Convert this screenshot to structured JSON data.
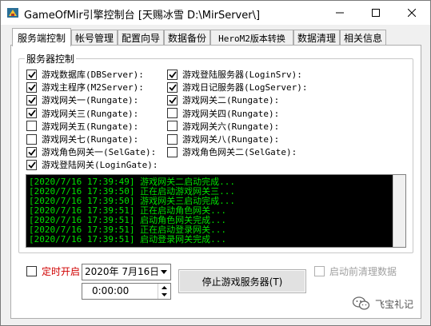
{
  "window": {
    "title": "GameOfMir引擎控制台 [天赐冰雪 D:\\MirServer\\]"
  },
  "tabs": [
    {
      "label": "服务端控制",
      "active": true
    },
    {
      "label": "帐号管理",
      "active": false
    },
    {
      "label": "配置向导",
      "active": false
    },
    {
      "label": "数据备份",
      "active": false
    },
    {
      "label": "HeroM2版本转换",
      "active": false
    },
    {
      "label": "数据清理",
      "active": false
    },
    {
      "label": "相关信息",
      "active": false
    }
  ],
  "server_control": {
    "group_title": "服务器控制",
    "left_items": [
      {
        "label": "游戏数据库(DBServer):",
        "checked": true
      },
      {
        "label": "游戏主程序(M2Server):",
        "checked": true
      },
      {
        "label": "游戏网关一(Rungate):",
        "checked": true
      },
      {
        "label": "游戏网关三(Rungate):",
        "checked": true
      },
      {
        "label": "游戏网关五(Rungate):",
        "checked": false
      },
      {
        "label": "游戏网关七(Rungate):",
        "checked": false
      },
      {
        "label": "游戏角色网关一(SelGate):",
        "checked": true
      },
      {
        "label": "游戏登陆网关(LoginGate):",
        "checked": true
      }
    ],
    "right_items": [
      {
        "label": "游戏登陆服务器(LoginSrv):",
        "checked": true
      },
      {
        "label": "游戏日记服务器(LogServer):",
        "checked": true
      },
      {
        "label": "游戏网关二(Rungate):",
        "checked": true
      },
      {
        "label": "游戏网关四(Rungate):",
        "checked": false
      },
      {
        "label": "游戏网关六(Rungate):",
        "checked": false
      },
      {
        "label": "游戏网关八(Rungate):",
        "checked": false
      },
      {
        "label": "游戏角色网关二(SelGate):",
        "checked": false
      }
    ],
    "log_lines": [
      "[2020/7/16 17:39:49] 游戏网关二启动完成...",
      "[2020/7/16 17:39:50] 正在启动游戏网关三...",
      "[2020/7/16 17:39:50] 游戏网关三启动完成...",
      "[2020/7/16 17:39:51] 正在启动角色网关...",
      "[2020/7/16 17:39:51] 启动角色网关完成...",
      "[2020/7/16 17:39:51] 正在启动登录网关...",
      "[2020/7/16 17:39:51] 启动登录网关完成..."
    ]
  },
  "bottom": {
    "timer_label": "定时开启",
    "timer_checked": false,
    "date_value": "2020年  7月16日",
    "time_value": "0:00:00",
    "stop_button": "停止游戏服务器(T)",
    "clear_label": "启动前清理数据",
    "clear_checked": false
  },
  "watermark": {
    "text": "飞宝礼记"
  },
  "colors": {
    "log_bg": "#000000",
    "log_text": "#00e000",
    "timer_label": "#d00000"
  }
}
